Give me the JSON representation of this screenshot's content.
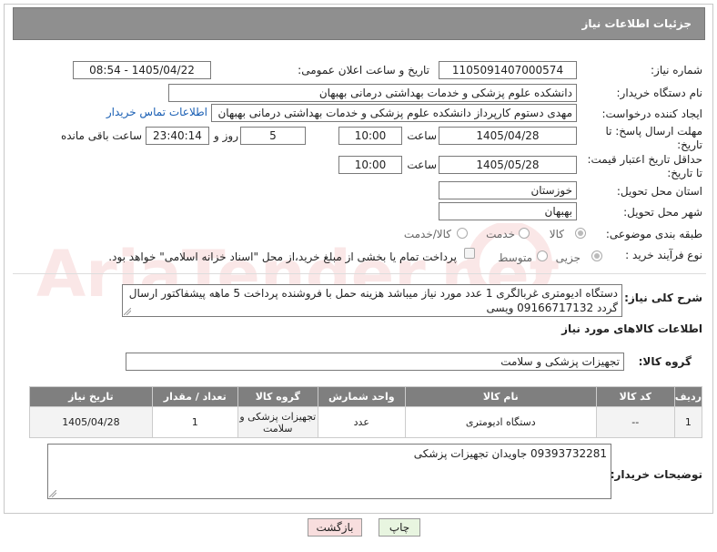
{
  "header": {
    "title": "جزئیات اطلاعات نیاز"
  },
  "need_number": {
    "label": "شماره نیاز:",
    "value": "1105091407000574"
  },
  "announce_datetime": {
    "label": "تاریخ و ساعت اعلان عمومی:",
    "value": "1405/04/22 - 08:54"
  },
  "buyer_org": {
    "label": "نام دستگاه خریدار:",
    "value": "دانشکده علوم پزشکی و خدمات بهداشتی  درمانی بهبهان"
  },
  "requester": {
    "label": "ایجاد کننده درخواست:",
    "value": "مهدی دستوم کارپرداز دانشکده علوم پزشکی و خدمات بهداشتی  درمانی بهبهان",
    "contact_link": "اطلاعات تماس خریدار"
  },
  "response_deadline": {
    "label_line1": "مهلت ارسال پاسخ: تا",
    "label_line2": "تاریخ:",
    "date": "1405/04/28",
    "time_label": "ساعت",
    "time": "10:00",
    "days": "5",
    "days_label": "روز و",
    "remaining": "23:40:14",
    "remaining_label": "ساعت باقی مانده"
  },
  "price_validity": {
    "label_line1": "حداقل تاریخ اعتبار قیمت:",
    "label_line2": "تا تاریخ:",
    "date": "1405/05/28",
    "time_label": "ساعت",
    "time": "10:00"
  },
  "province": {
    "label": "استان محل تحویل:",
    "value": "خوزستان"
  },
  "city": {
    "label": "شهر محل تحویل:",
    "value": "بهبهان"
  },
  "category": {
    "label": "طبقه بندی موضوعی:",
    "options": [
      "کالا",
      "خدمت",
      "کالا/خدمت"
    ]
  },
  "purchase_type": {
    "label": "نوع فرآیند خرید :",
    "options": [
      "جزیی",
      "متوسط"
    ],
    "payment_note": "پرداخت تمام یا بخشی از مبلغ خرید،از محل \"اسناد خزانه اسلامی\" خواهد بود."
  },
  "description": {
    "label": "شرح کلی نیاز:",
    "value": "دستگاه ادیومتری غربالگری 1 عدد مورد نیاز میباشد هزینه حمل با فروشنده پرداخت 5 ماهه پیشفاکتور ارسال گردد 09166717132 ویسی"
  },
  "goods_info": {
    "title": "اطلاعات کالاهای مورد نیاز"
  },
  "goods_group": {
    "label": "گروه کالا:",
    "value": "تجهیزات پزشکی و سلامت"
  },
  "table": {
    "headers": [
      "ردیف",
      "کد کالا",
      "نام کالا",
      "واحد شمارش",
      "گروه کالا",
      "تعداد / مقدار",
      "تاریخ نیاز"
    ],
    "rows": [
      {
        "row": "1",
        "code": "--",
        "name": "دستگاه ادیومتری",
        "unit": "عدد",
        "group": "تجهیزات پزشکی و سلامت",
        "qty": "1",
        "date": "1405/04/28"
      }
    ]
  },
  "buyer_notes": {
    "label": "توضیحات خریدار:",
    "value": "09393732281 جاویدان تجهیزات پزشکی"
  },
  "buttons": {
    "print": "چاپ",
    "back": "بازگشت"
  },
  "watermark": {
    "text": "AriaTender.net"
  },
  "colors": {
    "header_bg": "#8f8f8f",
    "table_header_bg": "#7f7f7f",
    "print_btn": "#e8f5e0",
    "back_btn": "#f8dede",
    "link": "#1a5fb4"
  }
}
